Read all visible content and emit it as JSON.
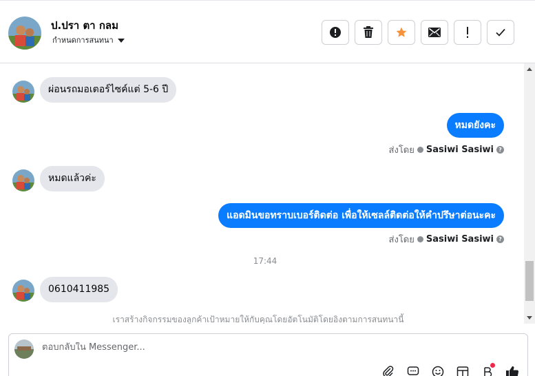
{
  "header": {
    "contact_name": "ป.ปรา ตา กลม",
    "assign_label": "กำหนดการสนทนา",
    "actions": [
      {
        "name": "spam-button",
        "icon": "alert-circle-icon"
      },
      {
        "name": "delete-button",
        "icon": "trash-icon"
      },
      {
        "name": "star-button",
        "icon": "star-icon",
        "color": "#f7923b"
      },
      {
        "name": "mark-unread-button",
        "icon": "envelope-icon"
      },
      {
        "name": "follow-up-button",
        "icon": "exclamation-icon"
      },
      {
        "name": "mark-done-button",
        "icon": "checkmark-icon"
      }
    ]
  },
  "messages": [
    {
      "side": "in",
      "text": "ผ่อนรถมอเตอร์ไซค์แต่ 5-6 ปี"
    },
    {
      "side": "out",
      "text": "หมดยังคะ",
      "sent_prefix": "ส่งโดย",
      "sent_by": "Sasiwi Sasiwi"
    },
    {
      "side": "in",
      "text": "หมดแล้วค่ะ"
    },
    {
      "side": "out",
      "text": "แอดมินขอทราบเบอร์ติดต่อ เพื่อให้เซลล์ติดต่อให้คำปรึษาต่อนะคะ",
      "sent_prefix": "ส่งโดย",
      "sent_by": "Sasiwi Sasiwi"
    },
    {
      "side": "in",
      "text": "0610411985"
    }
  ],
  "timestamp": "17:44",
  "notice": "เราสร้างกิจกรรมของลูกค้าเป้าหมายให้กับคุณโดยอัตโนมัติโดยอิงตามการสนทนานี้",
  "composer": {
    "placeholder": "ตอบกลับใน Messenger...",
    "icons": [
      "paperclip-icon",
      "saved-reply-icon",
      "emoji-icon",
      "store-icon",
      "payment-icon",
      "thumbs-up-icon"
    ]
  },
  "colors": {
    "accent": "#0a7cff",
    "incoming_bubble": "#e4e6eb",
    "star": "#f7923b"
  }
}
